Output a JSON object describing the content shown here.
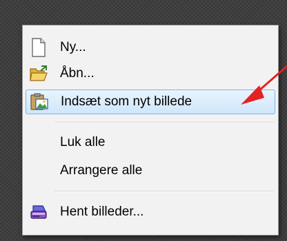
{
  "menu": {
    "items": [
      {
        "label": "Ny...",
        "icon": "new-document-icon"
      },
      {
        "label": "Åbn...",
        "icon": "open-folder-icon"
      },
      {
        "label": "Indsæt som nyt billede",
        "icon": "paste-image-icon"
      },
      {
        "label": "Luk alle",
        "icon": ""
      },
      {
        "label": "Arrangere alle",
        "icon": ""
      },
      {
        "label": "Hent billeder...",
        "icon": "scanner-icon"
      }
    ],
    "highlighted_index": 2,
    "highlight_color": "#cfe6fb",
    "highlight_border": "#7cb3e8"
  },
  "annotation": {
    "arrow_color": "#e32222"
  }
}
